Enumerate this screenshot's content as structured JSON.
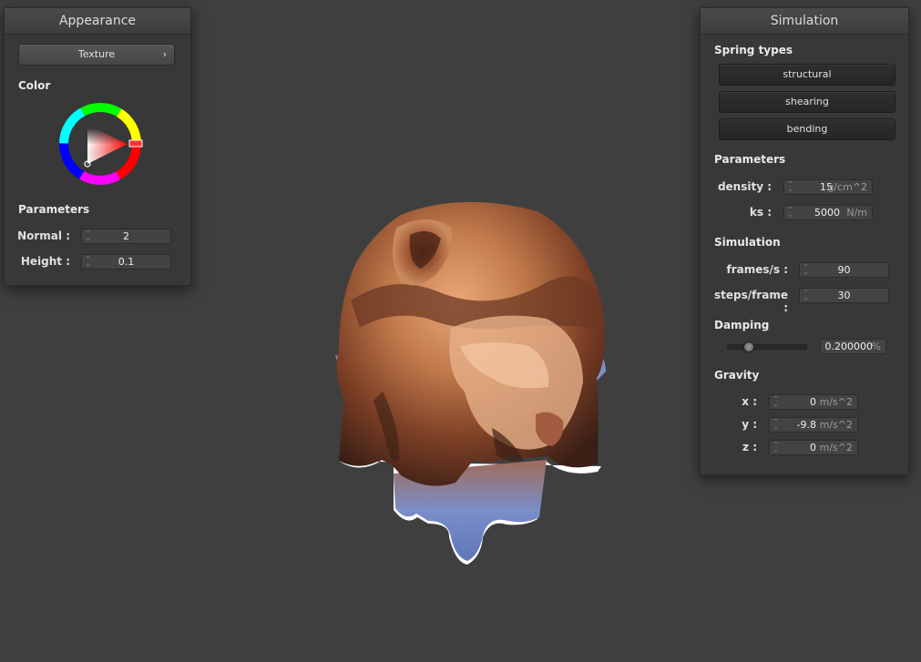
{
  "appearance": {
    "title": "Appearance",
    "shader_button": "Texture",
    "color_section": "Color",
    "params_section": "Parameters",
    "normal_label": "Normal :",
    "normal_value": "2",
    "height_label": "Height :",
    "height_value": "0.1",
    "wheel_color": "#ff0000"
  },
  "simulation": {
    "title": "Simulation",
    "spring_section": "Spring types",
    "spring_buttons": [
      "structural",
      "shearing",
      "bending"
    ],
    "params_section": "Parameters",
    "density_label": "density :",
    "density_value": "15",
    "density_unit": "g/cm^2",
    "ks_label": "ks :",
    "ks_value": "5000",
    "ks_unit": "N/m",
    "sim_section": "Simulation",
    "fps_label": "frames/s :",
    "fps_value": "90",
    "steps_label": "steps/frame :",
    "steps_value": "30",
    "damping_section": "Damping",
    "damping_value": "0.200000",
    "damping_unit": "%",
    "damping_slider_fraction": 0.2,
    "gravity_section": "Gravity",
    "gx_label": "x :",
    "gx_value": "0",
    "gy_label": "y :",
    "gy_value": "-9.8",
    "gz_label": "z :",
    "gz_value": "0",
    "gravity_unit": "m/s^2"
  },
  "viewport": {
    "background": "#3f3f3f",
    "cloth_colors": [
      "#8a4a2c",
      "#c0774a",
      "#e7a67a",
      "#7d8fc8"
    ]
  }
}
